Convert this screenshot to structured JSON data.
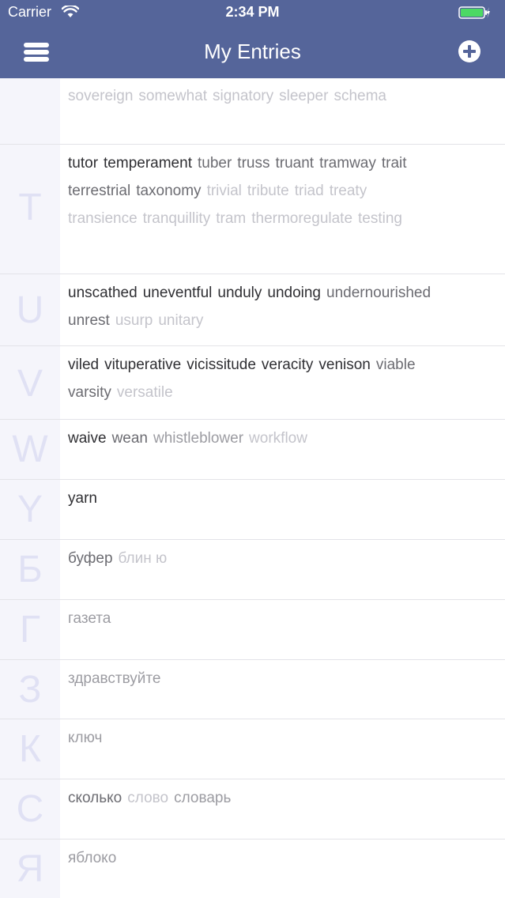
{
  "status_bar": {
    "carrier": "Carrier",
    "time": "2:34 PM",
    "wifi_icon": "wifi-icon",
    "battery_icon": "battery-charging-icon",
    "battery_color": "#4cd964"
  },
  "nav": {
    "title": "My Entries",
    "menu_icon": "hamburger-menu-icon",
    "add_icon": "plus-circle-icon",
    "background_color": "#55659a"
  },
  "sections": [
    {
      "letter": "",
      "lines": [
        [
          {
            "text": "sovereign",
            "shade": 4
          },
          {
            "text": "somewhat",
            "shade": 4
          },
          {
            "text": "signatory",
            "shade": 4
          },
          {
            "text": "sleeper",
            "shade": 4
          },
          {
            "text": "schema",
            "shade": 4
          }
        ]
      ]
    },
    {
      "letter": "T",
      "lines": [
        [
          {
            "text": "tutor",
            "shade": 1
          },
          {
            "text": "temperament",
            "shade": 1
          },
          {
            "text": "tuber",
            "shade": 2
          },
          {
            "text": "truss",
            "shade": 2
          },
          {
            "text": "truant",
            "shade": 2
          },
          {
            "text": "tramway",
            "shade": 2
          },
          {
            "text": "trait",
            "shade": 2
          }
        ],
        [
          {
            "text": "terrestrial",
            "shade": 2
          },
          {
            "text": "taxonomy",
            "shade": 2
          },
          {
            "text": "trivial",
            "shade": 4
          },
          {
            "text": "tribute",
            "shade": 4
          },
          {
            "text": "triad",
            "shade": 4
          },
          {
            "text": "treaty",
            "shade": 4
          }
        ],
        [
          {
            "text": "transience",
            "shade": 4
          },
          {
            "text": "tranquillity",
            "shade": 4
          },
          {
            "text": "tram",
            "shade": 4
          },
          {
            "text": "thermoregulate",
            "shade": 4
          },
          {
            "text": "testing",
            "shade": 4
          }
        ]
      ]
    },
    {
      "letter": "U",
      "lines": [
        [
          {
            "text": "unscathed",
            "shade": 1
          },
          {
            "text": "uneventful",
            "shade": 1
          },
          {
            "text": "unduly",
            "shade": 1
          },
          {
            "text": "undoing",
            "shade": 1
          },
          {
            "text": "undernourished",
            "shade": 2
          }
        ],
        [
          {
            "text": "unrest",
            "shade": 2
          },
          {
            "text": "usurp",
            "shade": 4
          },
          {
            "text": "unitary",
            "shade": 4
          }
        ]
      ]
    },
    {
      "letter": "V",
      "lines": [
        [
          {
            "text": "viled",
            "shade": 1
          },
          {
            "text": "vituperative",
            "shade": 1
          },
          {
            "text": "vicissitude",
            "shade": 1
          },
          {
            "text": "veracity",
            "shade": 1
          },
          {
            "text": "venison",
            "shade": 1
          },
          {
            "text": "viable",
            "shade": 2
          }
        ],
        [
          {
            "text": "varsity",
            "shade": 2
          },
          {
            "text": "versatile",
            "shade": 4
          }
        ]
      ]
    },
    {
      "letter": "W",
      "lines": [
        [
          {
            "text": "waive",
            "shade": 1
          },
          {
            "text": "wean",
            "shade": 2
          },
          {
            "text": "whistleblower",
            "shade": 3
          },
          {
            "text": "workflow",
            "shade": 4
          }
        ]
      ]
    },
    {
      "letter": "Y",
      "lines": [
        [
          {
            "text": "yarn",
            "shade": 1
          }
        ]
      ]
    },
    {
      "letter": "Б",
      "lines": [
        [
          {
            "text": "буфер",
            "shade": 2
          },
          {
            "text": "блин ю",
            "shade": 4
          }
        ]
      ]
    },
    {
      "letter": "Г",
      "lines": [
        [
          {
            "text": "газета",
            "shade": 3
          }
        ]
      ]
    },
    {
      "letter": "З",
      "lines": [
        [
          {
            "text": "здравствуйте",
            "shade": 3
          }
        ]
      ]
    },
    {
      "letter": "К",
      "lines": [
        [
          {
            "text": "ключ",
            "shade": 3
          }
        ]
      ]
    },
    {
      "letter": "С",
      "lines": [
        [
          {
            "text": "сколько",
            "shade": 2
          },
          {
            "text": "слово",
            "shade": 4
          },
          {
            "text": "словарь",
            "shade": 3
          }
        ]
      ]
    },
    {
      "letter": "Я",
      "lines": [
        [
          {
            "text": "яблоко",
            "shade": 3
          }
        ]
      ]
    }
  ]
}
